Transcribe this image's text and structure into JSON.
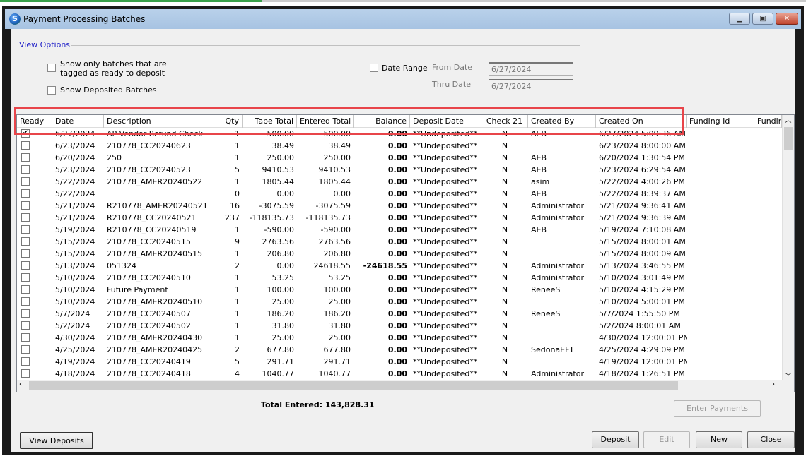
{
  "window": {
    "title": "Payment Processing Batches",
    "app_icon_letter": "S",
    "minimize": "▁",
    "maximize": "▣",
    "close": "✕"
  },
  "view_options": {
    "label": "View Options",
    "show_ready": {
      "label_line1": "Show only batches that are",
      "label_line2": "tagged as ready to deposit",
      "checked": false
    },
    "show_deposited": {
      "label": "Show Deposited Batches",
      "checked": false
    },
    "date_range": {
      "label": "Date Range",
      "checked": false
    },
    "from_date": {
      "label": "From Date",
      "value": "6/27/2024"
    },
    "thru_date": {
      "label": "Thru Date",
      "value": "6/27/2024"
    }
  },
  "grid": {
    "columns": [
      "Ready",
      "Date",
      "Description",
      "Qty",
      "Tape Total",
      "Entered Total",
      "Balance",
      "Deposit Date",
      "Check 21",
      "Created By",
      "Created On",
      "Funding Id",
      "Funding"
    ],
    "rows": [
      {
        "ready": true,
        "date": "6/27/2024",
        "desc": "AP Vendor Refund Check",
        "qty": "1",
        "tape": "500.00",
        "entered": "500.00",
        "balance": "0.00",
        "deposit": "**Undeposited**",
        "check21": "N",
        "by": "AEB",
        "on": "6/27/2024 5:09:36 AM"
      },
      {
        "ready": false,
        "date": "6/23/2024",
        "desc": "210778_CC20240623",
        "qty": "1",
        "tape": "38.49",
        "entered": "38.49",
        "balance": "0.00",
        "deposit": "**Undeposited**",
        "check21": "N",
        "by": "",
        "on": "6/23/2024 8:00:00 AM"
      },
      {
        "ready": false,
        "date": "6/20/2024",
        "desc": "250",
        "qty": "1",
        "tape": "250.00",
        "entered": "250.00",
        "balance": "0.00",
        "deposit": "**Undeposited**",
        "check21": "N",
        "by": "AEB",
        "on": "6/20/2024 1:30:54 PM"
      },
      {
        "ready": false,
        "date": "5/23/2024",
        "desc": "210778_CC20240523",
        "qty": "5",
        "tape": "9410.53",
        "entered": "9410.53",
        "balance": "0.00",
        "deposit": "**Undeposited**",
        "check21": "N",
        "by": "AEB",
        "on": "5/23/2024 6:29:54 AM"
      },
      {
        "ready": false,
        "date": "5/22/2024",
        "desc": "210778_AMER20240522",
        "qty": "1",
        "tape": "1805.44",
        "entered": "1805.44",
        "balance": "0.00",
        "deposit": "**Undeposited**",
        "check21": "N",
        "by": "asim",
        "on": "5/22/2024 4:00:26 PM"
      },
      {
        "ready": false,
        "date": "5/22/2024",
        "desc": "",
        "qty": "0",
        "tape": "0.00",
        "entered": "0.00",
        "balance": "0.00",
        "deposit": "**Undeposited**",
        "check21": "N",
        "by": "AEB",
        "on": "5/22/2024 8:39:37 AM"
      },
      {
        "ready": false,
        "date": "5/21/2024",
        "desc": "R210778_AMER20240521",
        "qty": "16",
        "tape": "-3075.59",
        "entered": "-3075.59",
        "balance": "0.00",
        "deposit": "**Undeposited**",
        "check21": "N",
        "by": "Administrator",
        "on": "5/21/2024 9:36:41 AM"
      },
      {
        "ready": false,
        "date": "5/21/2024",
        "desc": "R210778_CC20240521",
        "qty": "237",
        "tape": "-118135.73",
        "entered": "-118135.73",
        "balance": "0.00",
        "deposit": "**Undeposited**",
        "check21": "N",
        "by": "Administrator",
        "on": "5/21/2024 9:36:39 AM"
      },
      {
        "ready": false,
        "date": "5/19/2024",
        "desc": "R210778_CC20240519",
        "qty": "1",
        "tape": "-590.00",
        "entered": "-590.00",
        "balance": "0.00",
        "deposit": "**Undeposited**",
        "check21": "N",
        "by": "AEB",
        "on": "5/19/2024 7:10:08 AM"
      },
      {
        "ready": false,
        "date": "5/15/2024",
        "desc": "210778_CC20240515",
        "qty": "9",
        "tape": "2763.56",
        "entered": "2763.56",
        "balance": "0.00",
        "deposit": "**Undeposited**",
        "check21": "N",
        "by": "",
        "on": "5/15/2024 8:00:01 AM"
      },
      {
        "ready": false,
        "date": "5/15/2024",
        "desc": "210778_AMER20240515",
        "qty": "1",
        "tape": "206.80",
        "entered": "206.80",
        "balance": "0.00",
        "deposit": "**Undeposited**",
        "check21": "N",
        "by": "",
        "on": "5/15/2024 8:00:09 AM"
      },
      {
        "ready": false,
        "date": "5/13/2024",
        "desc": "051324",
        "qty": "2",
        "tape": "0.00",
        "entered": "24618.55",
        "balance": "-24618.55",
        "deposit": "**Undeposited**",
        "check21": "N",
        "by": "Administrator",
        "on": "5/13/2024 3:46:55 PM"
      },
      {
        "ready": false,
        "date": "5/10/2024",
        "desc": "210778_CC20240510",
        "qty": "1",
        "tape": "53.25",
        "entered": "53.25",
        "balance": "0.00",
        "deposit": "**Undeposited**",
        "check21": "N",
        "by": "Administrator",
        "on": "5/10/2024 3:01:49 PM"
      },
      {
        "ready": false,
        "date": "5/10/2024",
        "desc": "Future Payment",
        "qty": "1",
        "tape": "100.00",
        "entered": "100.00",
        "balance": "0.00",
        "deposit": "**Undeposited**",
        "check21": "N",
        "by": "ReneeS",
        "on": "5/10/2024 4:15:29 PM"
      },
      {
        "ready": false,
        "date": "5/10/2024",
        "desc": "210778_AMER20240510",
        "qty": "1",
        "tape": "25.00",
        "entered": "25.00",
        "balance": "0.00",
        "deposit": "**Undeposited**",
        "check21": "N",
        "by": "",
        "on": "5/10/2024 5:00:01 PM"
      },
      {
        "ready": false,
        "date": "5/7/2024",
        "desc": "210778_CC20240507",
        "qty": "1",
        "tape": "186.20",
        "entered": "186.20",
        "balance": "0.00",
        "deposit": "**Undeposited**",
        "check21": "N",
        "by": "ReneeS",
        "on": "5/7/2024 1:55:50 PM"
      },
      {
        "ready": false,
        "date": "5/2/2024",
        "desc": "210778_CC20240502",
        "qty": "1",
        "tape": "31.80",
        "entered": "31.80",
        "balance": "0.00",
        "deposit": "**Undeposited**",
        "check21": "N",
        "by": "",
        "on": "5/2/2024 8:00:01 AM"
      },
      {
        "ready": false,
        "date": "4/30/2024",
        "desc": "210778_AMER20240430",
        "qty": "1",
        "tape": "25.00",
        "entered": "25.00",
        "balance": "0.00",
        "deposit": "**Undeposited**",
        "check21": "N",
        "by": "",
        "on": "4/30/2024 12:00:01 PM"
      },
      {
        "ready": false,
        "date": "4/25/2024",
        "desc": "210778_AMER20240425",
        "qty": "2",
        "tape": "677.80",
        "entered": "677.80",
        "balance": "0.00",
        "deposit": "**Undeposited**",
        "check21": "N",
        "by": "SedonaEFT",
        "on": "4/25/2024 4:29:09 PM"
      },
      {
        "ready": false,
        "date": "4/19/2024",
        "desc": "210778_CC20240419",
        "qty": "5",
        "tape": "291.71",
        "entered": "291.71",
        "balance": "0.00",
        "deposit": "**Undeposited**",
        "check21": "N",
        "by": "",
        "on": "4/19/2024 12:00:01 PM"
      },
      {
        "ready": false,
        "date": "4/18/2024",
        "desc": "210778_CC20240418",
        "qty": "4",
        "tape": "1040.77",
        "entered": "1040.77",
        "balance": "0.00",
        "deposit": "**Undeposited**",
        "check21": "N",
        "by": "Administrator",
        "on": "4/18/2024 1:26:51 PM"
      }
    ]
  },
  "footer": {
    "total_entered": "Total Entered: 143,828.31",
    "enter_payments": "Enter Payments",
    "view_deposits": "View Deposits",
    "deposit": "Deposit",
    "edit": "Edit",
    "new": "New",
    "close": "Close"
  },
  "colors": {
    "highlight": "#e8454a",
    "group_label": "#2020c8",
    "titlebar": "#b9d1ea"
  }
}
